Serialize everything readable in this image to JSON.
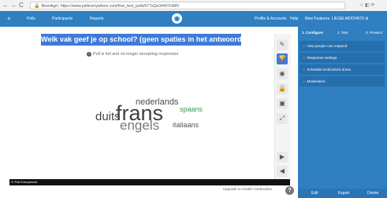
{
  "browser": {
    "back": "←",
    "forward": "→",
    "reload": "C",
    "url_secure": "Beveiligd",
    "url": "https://www.polleverywhere.com/free_text_polls/h77aQe344VYrA8V",
    "ext_icons": "☆ ◧ ⟳"
  },
  "topbar": {
    "plus": "+",
    "polls": "Polls",
    "participants": "Participants",
    "reports": "Reports",
    "profile_account": "Profile & Accounts",
    "help": "Help",
    "new_features": "New Features",
    "user": "LIESELMOOVA79 ⚙"
  },
  "question": "Welk vak geef je op school? (geen spaties in het antwoord aub)",
  "status": "Poll is full and no longer accepting responses",
  "wordcloud": {
    "nederlands": "nederlands",
    "frans": "frans",
    "duits": "duits",
    "spaans": "spaans",
    "engels": "engels",
    "italiaans": "italiaans"
  },
  "toolbar": {
    "edit": "✎",
    "trophy": "🏆",
    "eye": "◉",
    "lock": "🔒",
    "calendar": "▣",
    "fullscreen": "⤢",
    "next": "▶",
    "prev": "◀"
  },
  "footer": {
    "brand": "⊙ Poll Everywhere",
    "upgrade": "Upgrade to enable moderation",
    "help": "?"
  },
  "panel": {
    "tabs": [
      "1. Configure",
      "2. Test",
      "3. Present"
    ],
    "rows": [
      "How people can respond",
      "Response settings",
      "Schedule lock/unlock times",
      "Moderation"
    ],
    "caret": "›",
    "edit": "Edit",
    "export": "Export",
    "delete": "Delete"
  }
}
